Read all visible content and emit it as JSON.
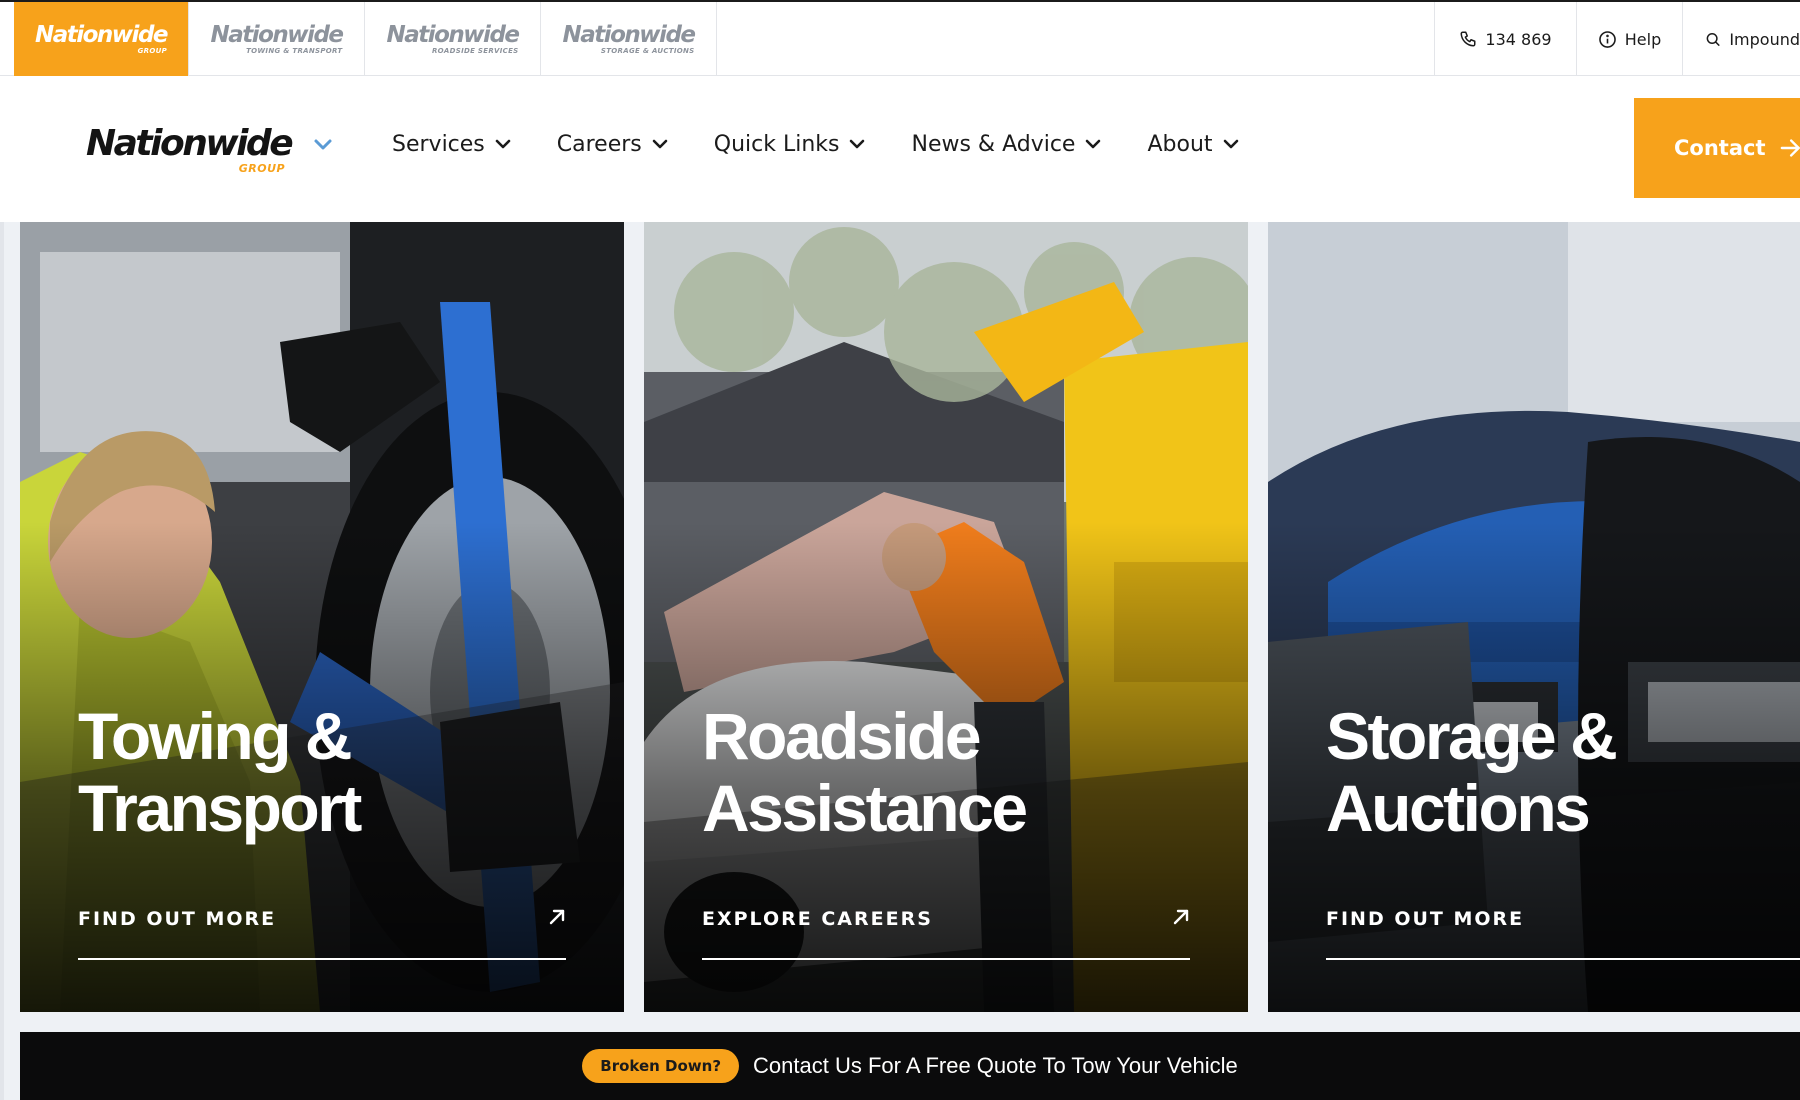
{
  "topbar": {
    "brand_tabs": [
      {
        "logo": "Nationwide",
        "sub": "GROUP",
        "active": true
      },
      {
        "logo": "Nationwide",
        "sub": "TOWING & TRANSPORT",
        "active": false
      },
      {
        "logo": "Nationwide",
        "sub": "ROADSIDE SERVICES",
        "active": false
      },
      {
        "logo": "Nationwide",
        "sub": "STORAGE & AUCTIONS",
        "active": false
      }
    ],
    "phone": "134 869",
    "help": "Help",
    "impound": "Impound"
  },
  "nav": {
    "logo": {
      "word": "Nationwide",
      "sub": "GROUP"
    },
    "items": [
      {
        "label": "Services"
      },
      {
        "label": "Careers"
      },
      {
        "label": "Quick Links"
      },
      {
        "label": "News & Advice"
      },
      {
        "label": "About"
      }
    ],
    "contact": "Contact"
  },
  "cards": [
    {
      "title_line1": "Towing &",
      "title_line2": "Transport",
      "cta": "FIND OUT MORE"
    },
    {
      "title_line1": "Roadside",
      "title_line2": "Assistance",
      "cta": "EXPLORE CAREERS"
    },
    {
      "title_line1": "Storage &",
      "title_line2": "Auctions",
      "cta": "FIND OUT MORE"
    }
  ],
  "banner": {
    "pill": "Broken Down?",
    "text": "Contact Us For A Free Quote To Tow Your Vehicle"
  },
  "colors": {
    "accent": "#f7a21b",
    "text_dark": "#1b1b1b",
    "banner_bg": "#0b0b0c",
    "page_bg": "#eef1f5"
  },
  "icons": {
    "phone": "phone-icon",
    "help": "info-circle-icon",
    "impound": "search-icon",
    "nav_chevron": "chevron-down-icon",
    "contact_arrow": "arrow-right-icon",
    "card_arrow": "arrow-up-right-icon"
  }
}
